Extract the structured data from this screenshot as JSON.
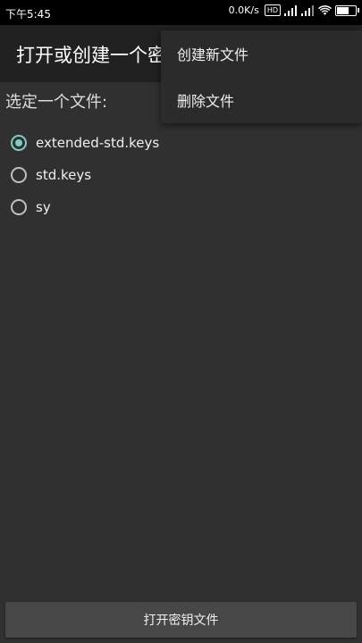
{
  "status_bar": {
    "time": "下午5:45",
    "net_speed": "0.0K/s",
    "hd_badge": "HD",
    "battery_level": 0.7
  },
  "app_bar": {
    "title": "打开或创建一个密"
  },
  "file_section": {
    "label": "选定一个文件:",
    "options": [
      {
        "label": "extended-std.keys",
        "checked": true
      },
      {
        "label": "std.keys",
        "checked": false
      },
      {
        "label": "sy",
        "checked": false
      }
    ]
  },
  "menu": {
    "items": [
      {
        "label": "创建新文件"
      },
      {
        "label": "删除文件"
      }
    ]
  },
  "bottom": {
    "open_button_label": "打开密钥文件"
  },
  "colors": {
    "accent": "#80cbc4",
    "background": "#303030",
    "app_bar": "#212121"
  },
  "icons": [
    "signal-icon",
    "wifi-icon",
    "battery-icon",
    "radio-button-icon"
  ]
}
